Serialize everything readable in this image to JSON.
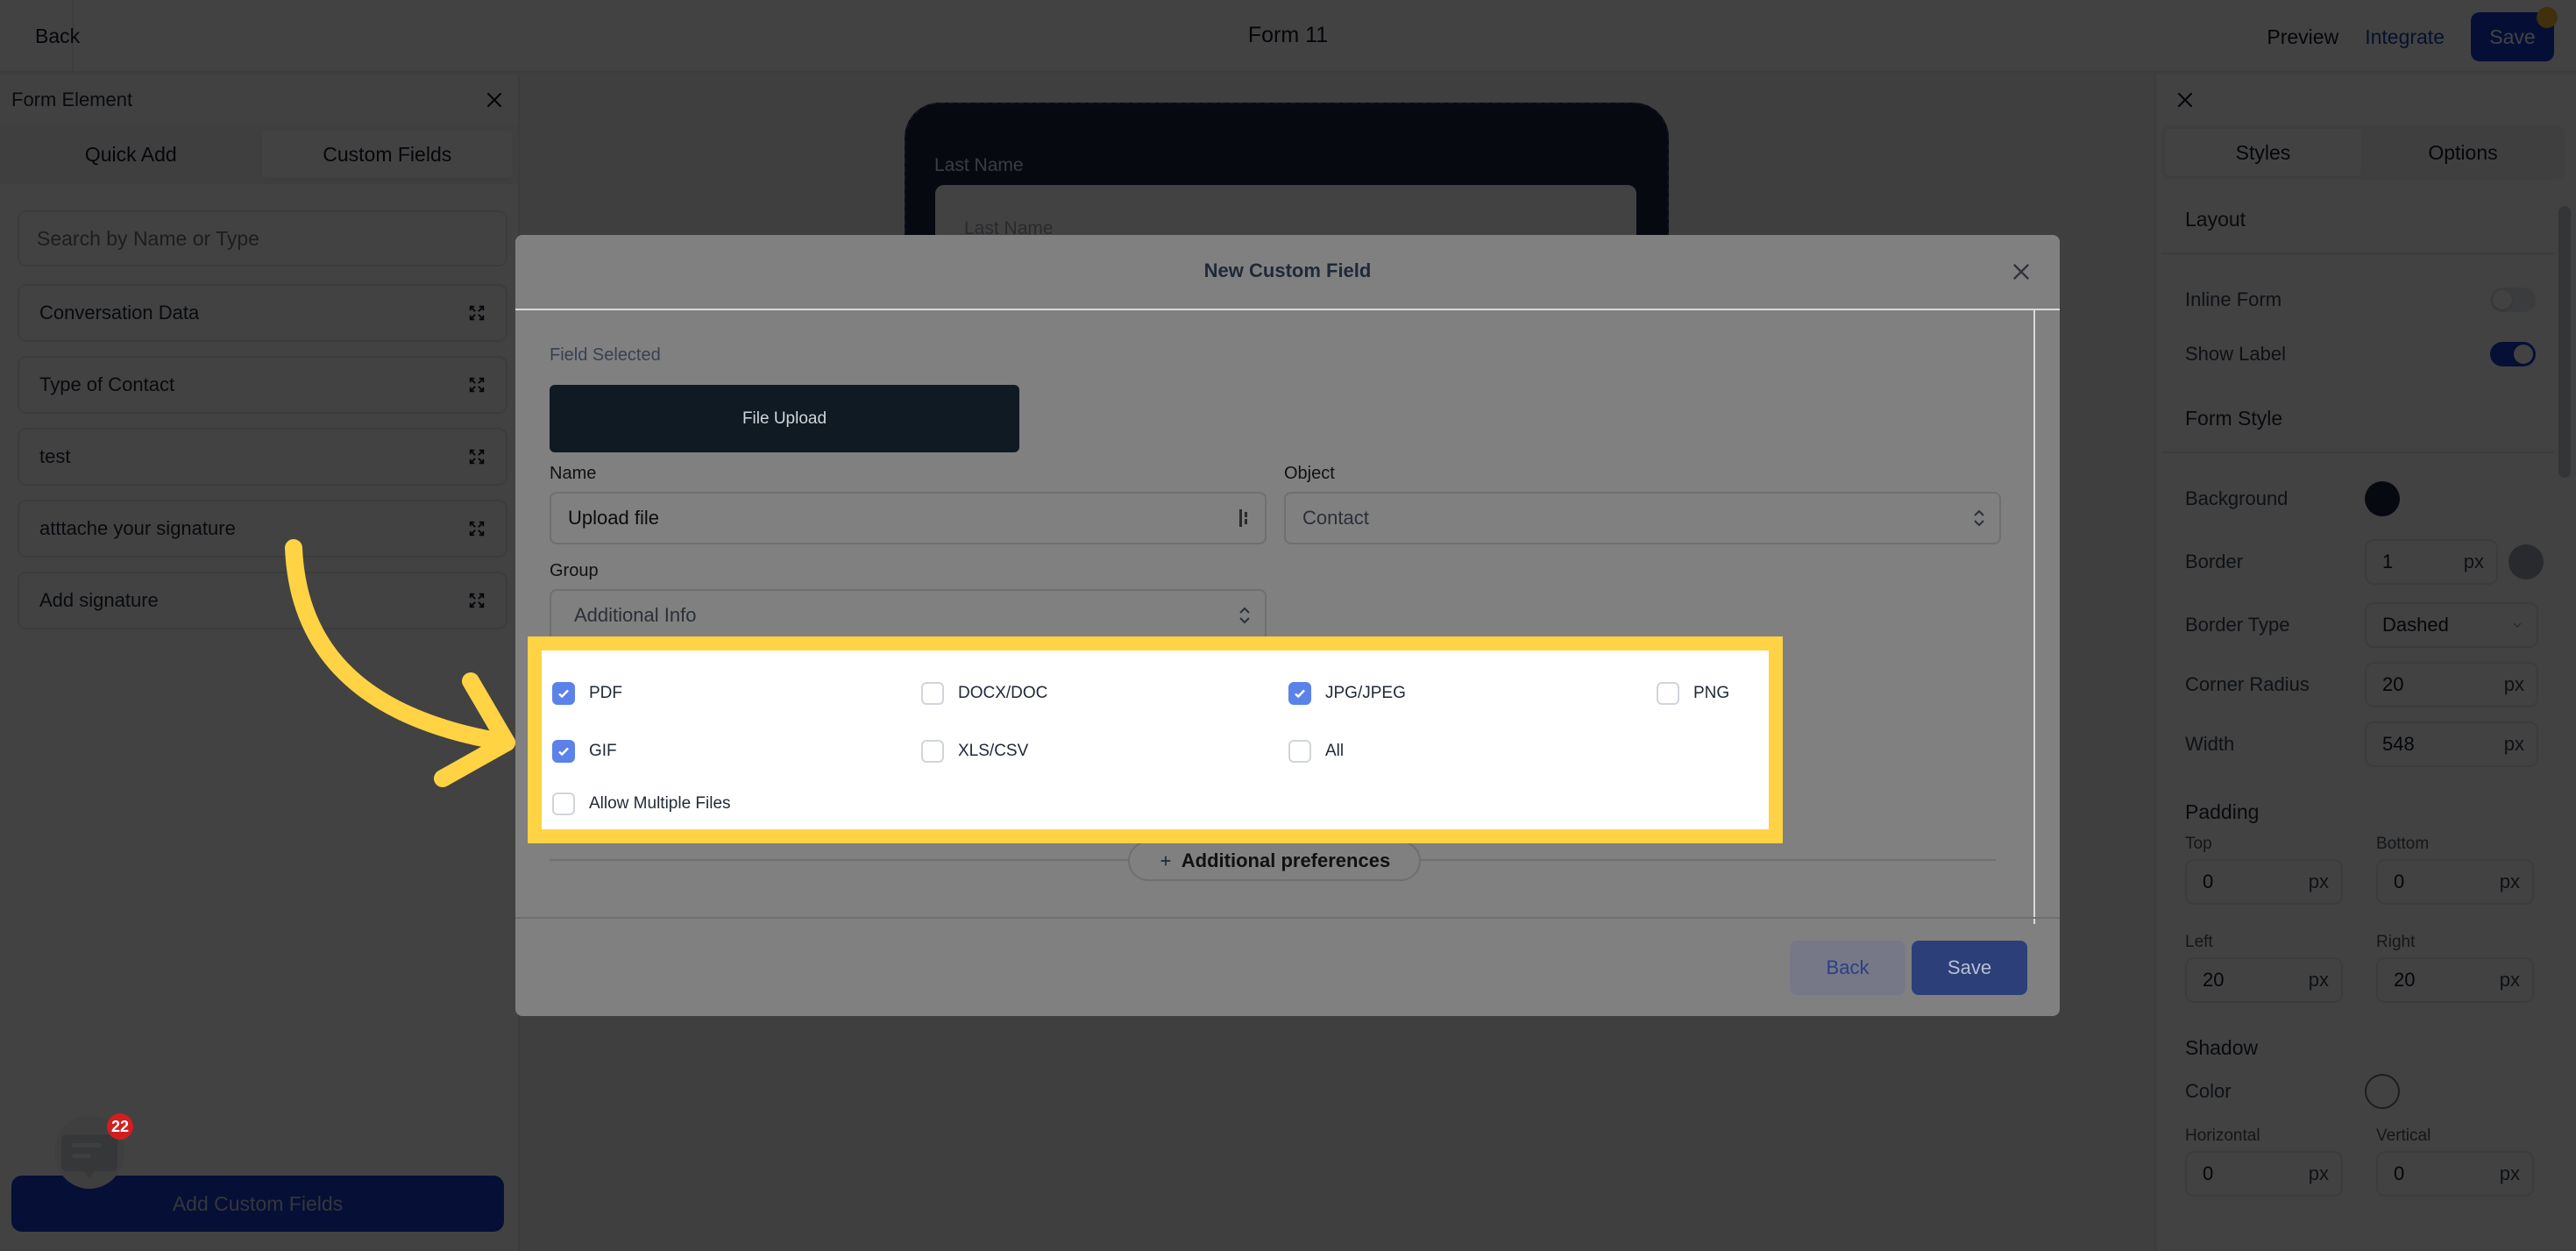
{
  "topbar": {
    "back_label": "Back",
    "title": "Form 11",
    "preview_label": "Preview",
    "integrate_label": "Integrate",
    "save_label": "Save"
  },
  "left_panel": {
    "title": "Form Element",
    "tabs": [
      {
        "label": "Quick Add",
        "active": false
      },
      {
        "label": "Custom Fields",
        "active": true
      }
    ],
    "search_placeholder": "Search by Name or Type",
    "items": [
      {
        "label": "Conversation Data"
      },
      {
        "label": "Type of Contact"
      },
      {
        "label": "test"
      },
      {
        "label": "atttache your signature"
      },
      {
        "label": "Add signature"
      }
    ],
    "add_button_label": "Add Custom Fields",
    "chat_badge_count": "22"
  },
  "canvas": {
    "form_field_label": "Last Name",
    "form_field_placeholder": "Last Name"
  },
  "right_panel": {
    "tabs": [
      {
        "label": "Styles",
        "active": true
      },
      {
        "label": "Options",
        "active": false
      }
    ],
    "layout_section": "Layout",
    "inline_form_label": "Inline Form",
    "inline_form_on": false,
    "show_label_label": "Show Label",
    "show_label_on": true,
    "form_style_section": "Form Style",
    "background_label": "Background",
    "background_color": "#1b2444",
    "border_label": "Border",
    "border_value": "1",
    "border_color": "#9ca3af",
    "unit": "px",
    "border_type_label": "Border Type",
    "border_type_value": "Dashed",
    "corner_radius_label": "Corner Radius",
    "corner_radius_value": "20",
    "width_label": "Width",
    "width_value": "548",
    "padding_section": "Padding",
    "padding_top_label": "Top",
    "padding_top_value": "0",
    "padding_bottom_label": "Bottom",
    "padding_bottom_value": "0",
    "padding_left_label": "Left",
    "padding_left_value": "20",
    "padding_right_label": "Right",
    "padding_right_value": "20",
    "shadow_section": "Shadow",
    "shadow_color_label": "Color",
    "shadow_color": "#ffffff",
    "horizontal_label": "Horizontal",
    "horizontal_value": "0",
    "vertical_label": "Vertical",
    "vertical_value": "0"
  },
  "modal": {
    "title": "New Custom Field",
    "field_selected_label": "Field Selected",
    "field_selected_value": "File Upload",
    "name_label": "Name",
    "name_value": "Upload file",
    "object_label": "Object",
    "object_value": "Contact",
    "group_label": "Group",
    "group_value": "Additional Info",
    "file_types": [
      {
        "label": "PDF",
        "checked": true
      },
      {
        "label": "DOCX/DOC",
        "checked": false
      },
      {
        "label": "JPG/JPEG",
        "checked": true
      },
      {
        "label": "PNG",
        "checked": false
      },
      {
        "label": "GIF",
        "checked": true
      },
      {
        "label": "XLS/CSV",
        "checked": false
      },
      {
        "label": "All",
        "checked": false
      }
    ],
    "allow_multiple_label": "Allow Multiple Files",
    "allow_multiple_checked": false,
    "additional_preferences_label": "Additional preferences",
    "back_label": "Back",
    "save_label": "Save"
  },
  "colors": {
    "primary": "#153ad1",
    "checkbox_checked": "#5b82ea",
    "highlight": "#ffd343"
  }
}
